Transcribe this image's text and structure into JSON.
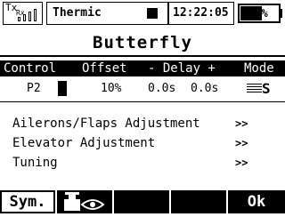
{
  "status_bar": {
    "tx_label": "Tx",
    "rx_label": "Rx",
    "model_name": "Thermic",
    "clock": "12:22:05",
    "battery_percent": 57,
    "battery_text": "57%"
  },
  "page": {
    "title": "Butterfly"
  },
  "table": {
    "headers": {
      "control": "Control",
      "offset": "Offset",
      "delay": "- Delay +",
      "mode": "Mode"
    },
    "row": {
      "control": "P2",
      "offset": "10%",
      "delay_minus": "0.0s",
      "delay_plus": "0.0s",
      "mode": "S"
    }
  },
  "menu": [
    {
      "label": "Ailerons/Flaps Adjustment",
      "arrow": ">>"
    },
    {
      "label": "Elevator Adjustment",
      "arrow": ">>"
    },
    {
      "label": "Tuning",
      "arrow": ">>"
    }
  ],
  "softkeys": {
    "sym": "Sym.",
    "ok": "Ok"
  }
}
